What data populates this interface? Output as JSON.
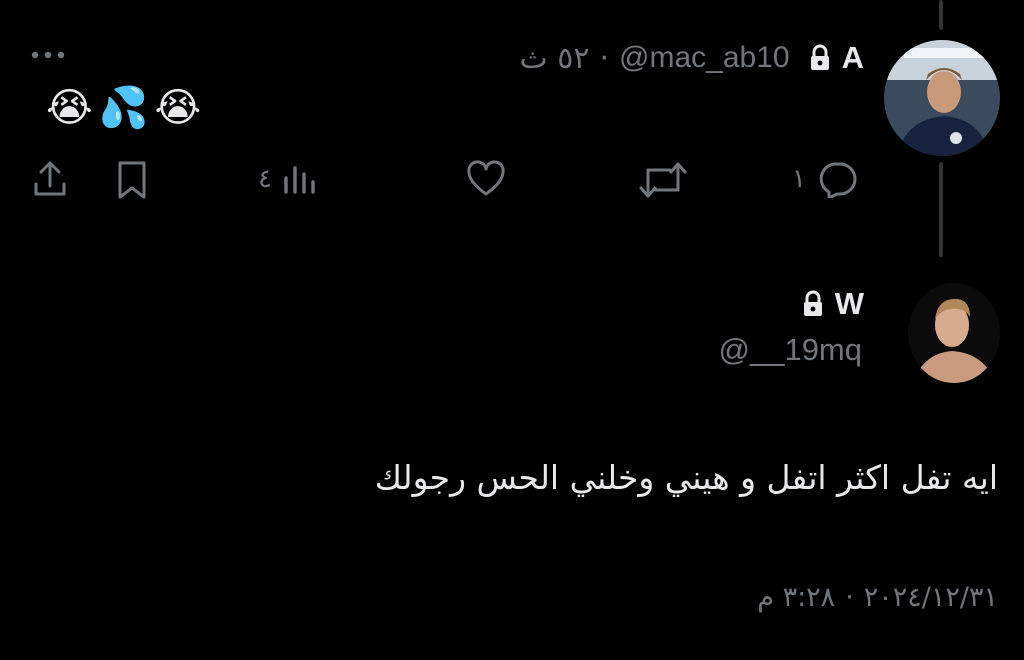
{
  "parent_tweet": {
    "display_name": "A",
    "handle": "@mac_ab10",
    "separator": "·",
    "time": "٥٢ ث",
    "text_emojis": "😭💦😭",
    "actions": {
      "reply_count": "١",
      "views_count": "٤"
    }
  },
  "main_tweet": {
    "display_name": "W",
    "handle": "@__19mq",
    "text": "ايه تفل اكثر اتفل و هيني وخلني الحس رجولك",
    "timestamp_time": "٣:٢٨ م",
    "timestamp_sep": "·",
    "timestamp_date": "٢٠٢٤/١٢/٣١"
  },
  "colors": {
    "background": "#000000",
    "text": "#e7e9ea",
    "muted": "#71767b",
    "thread_line": "#333639"
  }
}
